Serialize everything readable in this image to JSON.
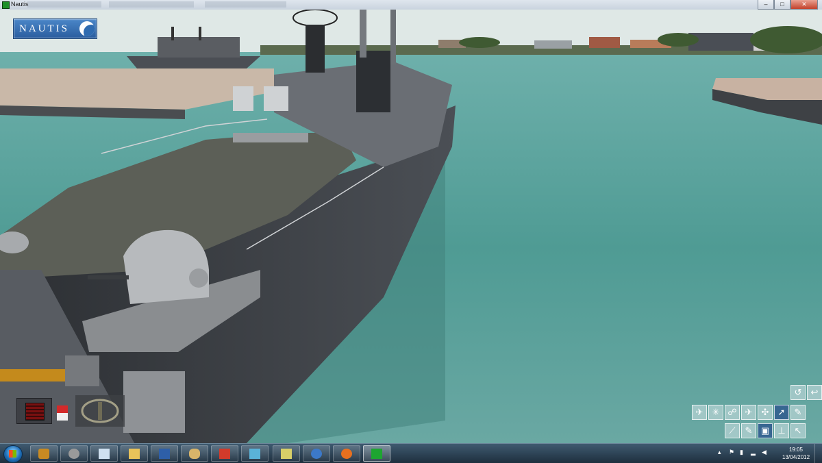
{
  "window": {
    "title": "Nautis",
    "minimize_label": "–",
    "maximize_label": "□",
    "close_label": "✕"
  },
  "scene": {
    "logo_text": "NAUTIS",
    "sky_color": "#dfe8e6",
    "water_color": "#4f9b94",
    "hull_color": "#3e4247",
    "deck_color": "#5c5f57"
  },
  "hud": {
    "status_colors": [
      "#d32a2a",
      "#f0f0f0"
    ],
    "camera_buttons": [
      {
        "icon": "undo-icon",
        "glyph": "↺",
        "active": false
      },
      {
        "icon": "return-icon",
        "glyph": "↩",
        "active": false
      },
      {
        "icon": "aircraft-icon",
        "glyph": "✈",
        "active": false
      },
      {
        "icon": "star-view-icon",
        "glyph": "✳",
        "active": false
      },
      {
        "icon": "figure-view-icon",
        "glyph": "☍",
        "active": false
      },
      {
        "icon": "plane-view-icon",
        "glyph": "✈",
        "active": false
      },
      {
        "icon": "helicopter-view-icon",
        "glyph": "✣",
        "active": false
      },
      {
        "icon": "pointer-view-icon",
        "glyph": "➚",
        "active": true
      },
      {
        "icon": "wrench-view-icon",
        "glyph": "✎",
        "active": false
      },
      {
        "icon": "rifle-icon",
        "glyph": "⟋",
        "active": false
      },
      {
        "icon": "pen-icon",
        "glyph": "✎",
        "active": false
      },
      {
        "icon": "camera-icon",
        "glyph": "▣",
        "active": true
      },
      {
        "icon": "pin-icon",
        "glyph": "⊥",
        "active": false
      },
      {
        "icon": "arrow-icon",
        "glyph": "↖",
        "active": false
      }
    ]
  },
  "taskbar": {
    "apps": [
      {
        "icon": "security-shield-icon",
        "color": "#c88a22"
      },
      {
        "icon": "settings-gear-icon",
        "color": "#9a9a9a"
      },
      {
        "icon": "notepad-icon",
        "color": "#cfe0f0"
      },
      {
        "icon": "file-explorer-icon",
        "color": "#e8c25a"
      },
      {
        "icon": "word-document-icon",
        "color": "#2e5fa8"
      },
      {
        "icon": "hand-tool-icon",
        "color": "#d7b46a"
      },
      {
        "icon": "gmail-icon",
        "color": "#d23b2b"
      },
      {
        "icon": "tablet-app-icon",
        "color": "#5ab2d8"
      },
      {
        "icon": "chat-app-icon",
        "color": "#d8cf68"
      },
      {
        "icon": "thunderbird-mail-icon",
        "color": "#3c79c8"
      },
      {
        "icon": "firefox-icon",
        "color": "#e8701f"
      },
      {
        "icon": "media-player-icon",
        "color": "#1ea531"
      }
    ],
    "clock_time": "19:05",
    "clock_date": "13/04/2012"
  }
}
